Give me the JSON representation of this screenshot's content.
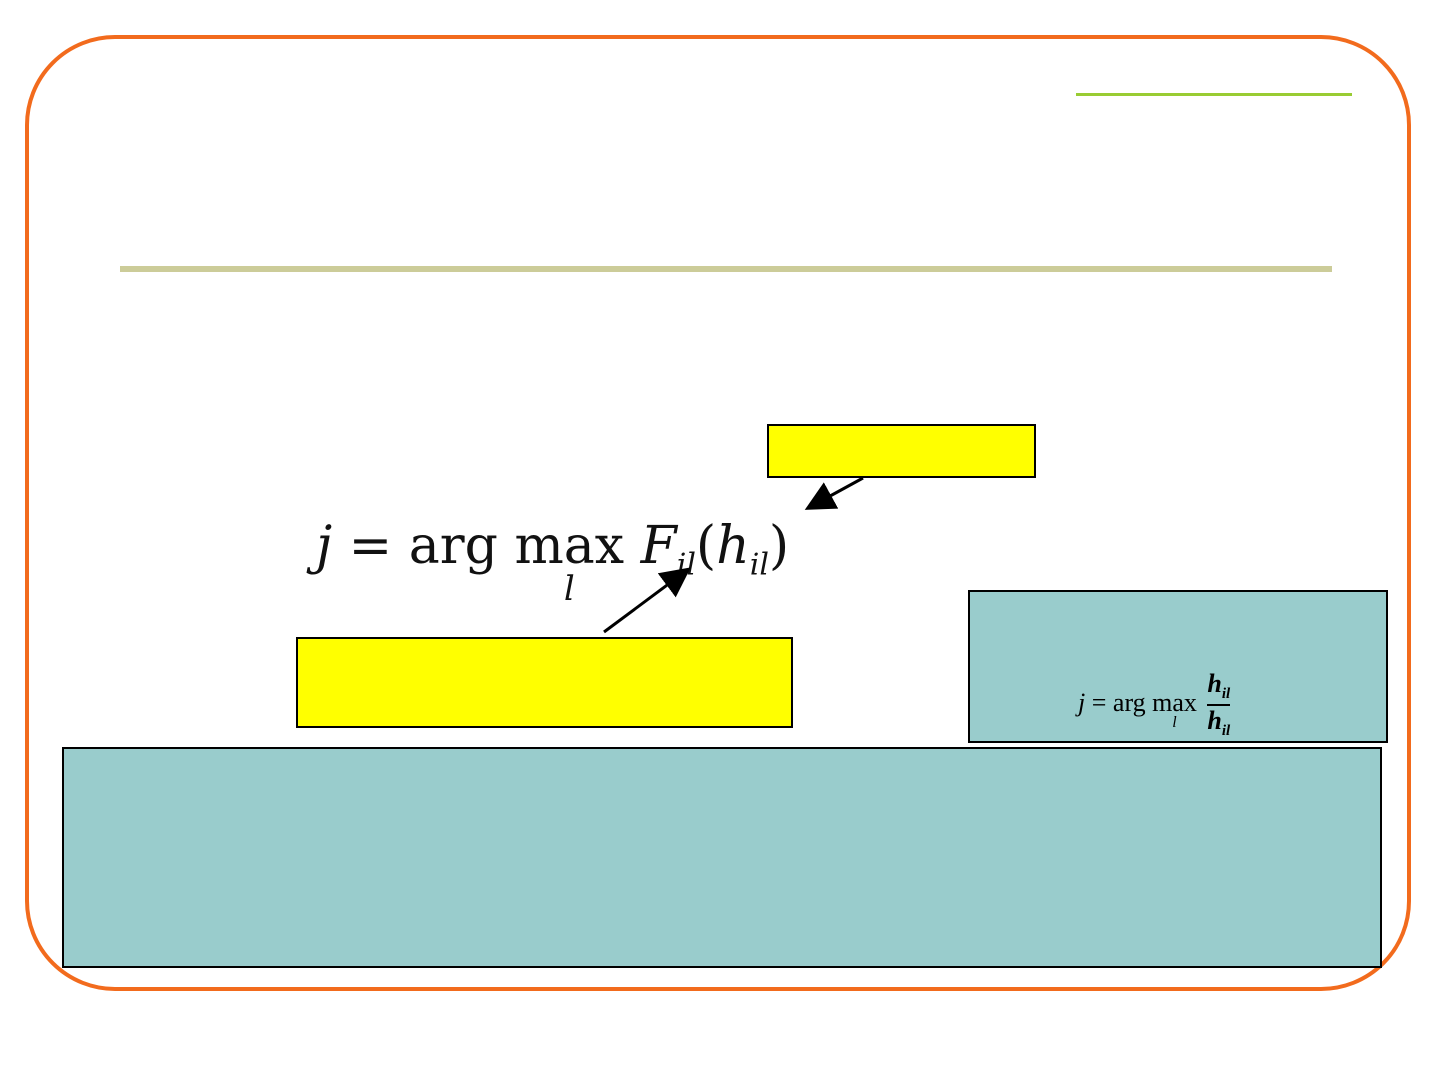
{
  "formula_main": {
    "lhs": "j",
    "equals": "=",
    "arg": "arg",
    "max": "max",
    "subscript": "l",
    "func": "F",
    "func_sub": "il",
    "open": "(",
    "var": "h",
    "var_sub": "il",
    "close": ")"
  },
  "formula_small": {
    "lhs": "j",
    "equals": "=",
    "arg": "arg",
    "max": "max",
    "subscript": "l",
    "num": "h",
    "num_sub": "il",
    "den": "h",
    "den_sub": "il"
  },
  "colors": {
    "frame_border": "#f26b1d",
    "accent_line": "#99cc33",
    "title_rule": "#cccc99",
    "callout_yellow": "#ffff00",
    "teal": "#99cccc"
  }
}
